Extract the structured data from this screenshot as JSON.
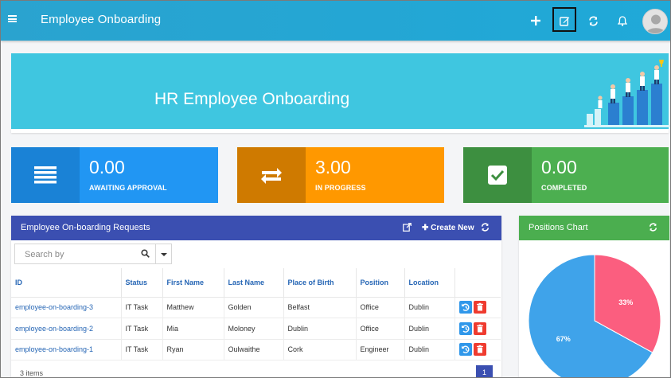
{
  "app": {
    "title": "Employee Onboarding"
  },
  "toolbar": {
    "add": "add-icon",
    "edit": "edit-icon",
    "refresh": "refresh-icon",
    "notifications": "bell-icon"
  },
  "banner": {
    "title": "HR Employee Onboarding"
  },
  "stats": [
    {
      "value": "0.00",
      "label": "AWAITING APPROVAL",
      "color": "#2196f3",
      "icon_bg": "#1a82d6",
      "icon": "list-icon"
    },
    {
      "value": "3.00",
      "label": "IN PROGRESS",
      "color": "#ff9800",
      "icon_bg": "#cf7a00",
      "icon": "repeat-icon"
    },
    {
      "value": "0.00",
      "label": "COMPLETED",
      "color": "#4caf50",
      "icon_bg": "#3d8f40",
      "icon": "check-icon"
    }
  ],
  "requests": {
    "title": "Employee On-boarding Requests",
    "create_label": "Create New",
    "search_placeholder": "Search by",
    "columns": [
      "ID",
      "Status",
      "First Name",
      "Last Name",
      "Place of Birth",
      "Position",
      "Location"
    ],
    "rows": [
      {
        "id": "employee-on-boarding-3",
        "status": "IT Task",
        "first": "Matthew",
        "last": "Golden",
        "birth": "Belfast",
        "position": "Office",
        "location": "Dublin"
      },
      {
        "id": "employee-on-boarding-2",
        "status": "IT Task",
        "first": "Mia",
        "last": "Moloney",
        "birth": "Dublin",
        "position": "Office",
        "location": "Dublin"
      },
      {
        "id": "employee-on-boarding-1",
        "status": "IT Task",
        "first": "Ryan",
        "last": "Oulwaithe",
        "birth": "Cork",
        "position": "Engineer",
        "location": "Dublin"
      }
    ],
    "items_count": "3 items",
    "page": "1"
  },
  "positions_chart": {
    "title": "Positions Chart"
  },
  "chart_data": {
    "type": "pie",
    "title": "Positions Chart",
    "slices": [
      {
        "label": "67%",
        "value": 67,
        "color": "#3fa3ea"
      },
      {
        "label": "33%",
        "value": 33,
        "color": "#fb5e7f"
      }
    ]
  }
}
